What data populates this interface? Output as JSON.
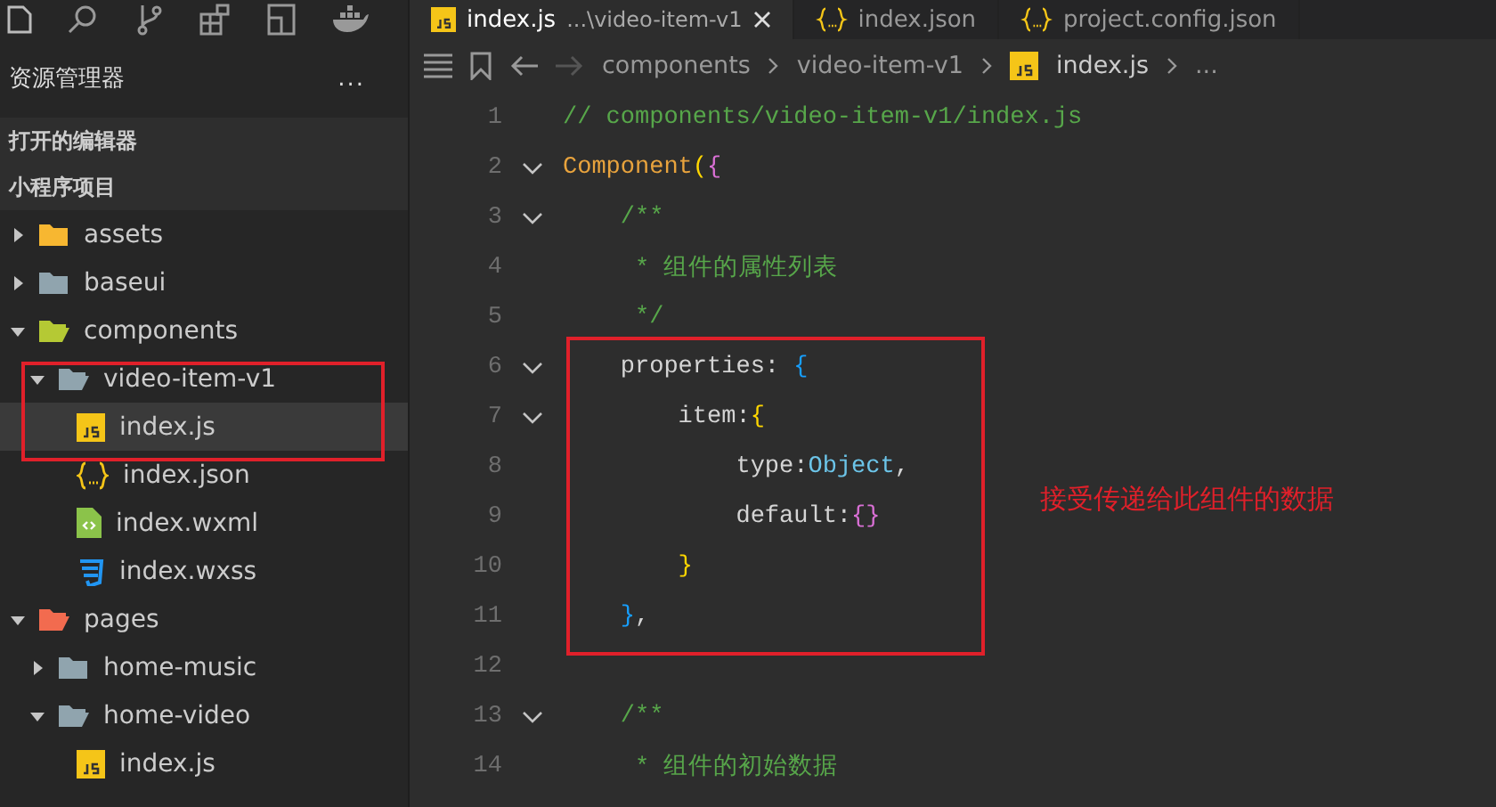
{
  "tabs": [
    {
      "label": "index.js",
      "description": "...\\video-item-v1",
      "kind": "js",
      "selected": true
    },
    {
      "label": "index.json",
      "kind": "json",
      "selected": false
    },
    {
      "label": "project.config.json",
      "kind": "json",
      "selected": false
    }
  ],
  "sidebar": {
    "title": "资源管理器",
    "more": "...",
    "sections": [
      "打开的编辑器",
      "小程序项目"
    ],
    "tree": [
      {
        "label": "assets",
        "kind": "folder-assets",
        "expanded": false
      },
      {
        "label": "baseui",
        "kind": "folder",
        "expanded": false
      },
      {
        "label": "components",
        "kind": "folder-components",
        "expanded": true,
        "children": [
          {
            "label": "video-item-v1",
            "kind": "folder",
            "expanded": true,
            "children": [
              {
                "label": "index.js",
                "kind": "js",
                "selected": true
              },
              {
                "label": "index.json",
                "kind": "json",
                "selected": false
              },
              {
                "label": "index.wxml",
                "kind": "wxml",
                "selected": false
              },
              {
                "label": "index.wxss",
                "kind": "wxss",
                "selected": false
              }
            ]
          }
        ]
      },
      {
        "label": "pages",
        "kind": "folder-pages",
        "expanded": true,
        "children": [
          {
            "label": "home-music",
            "kind": "folder",
            "expanded": false
          },
          {
            "label": "home-video",
            "kind": "folder",
            "expanded": true,
            "children": [
              {
                "label": "index.js",
                "kind": "js",
                "selected": false
              }
            ]
          }
        ]
      }
    ]
  },
  "breadcrumb": [
    {
      "label": "components",
      "kind": "folder"
    },
    {
      "label": "video-item-v1",
      "kind": "folder"
    },
    {
      "label": "index.js",
      "kind": "js"
    },
    {
      "label": "...",
      "kind": "more"
    }
  ],
  "code": {
    "lines": [
      {
        "number": "1",
        "fold": false,
        "tokens": [
          {
            "text": "// components/video-item-v1/index.js",
            "kind": "comment"
          }
        ]
      },
      {
        "number": "2",
        "fold": true,
        "tokens": [
          {
            "text": "Component",
            "kind": "function"
          },
          {
            "text": "(",
            "kind": "bracket1"
          },
          {
            "text": "{",
            "kind": "bracket2"
          }
        ]
      },
      {
        "number": "3",
        "fold": true,
        "tokens": [
          {
            "text": "    /**",
            "kind": "comment"
          }
        ]
      },
      {
        "number": "4",
        "fold": false,
        "tokens": [
          {
            "text": "     * 组件的属性列表",
            "kind": "comment"
          }
        ]
      },
      {
        "number": "5",
        "fold": false,
        "tokens": [
          {
            "text": "     */",
            "kind": "comment"
          }
        ]
      },
      {
        "number": "6",
        "fold": true,
        "tokens": [
          {
            "text": "    properties: ",
            "kind": "plain"
          },
          {
            "text": "{",
            "kind": "bracket3"
          }
        ]
      },
      {
        "number": "7",
        "fold": true,
        "tokens": [
          {
            "text": "        item:",
            "kind": "plain"
          },
          {
            "text": "{",
            "kind": "bracket1"
          }
        ]
      },
      {
        "number": "8",
        "fold": false,
        "tokens": [
          {
            "text": "            type:",
            "kind": "plain"
          },
          {
            "text": "Object",
            "kind": "type"
          },
          {
            "text": ",",
            "kind": "plain"
          }
        ]
      },
      {
        "number": "9",
        "fold": false,
        "tokens": [
          {
            "text": "            default:",
            "kind": "plain"
          },
          {
            "text": "{}",
            "kind": "bracket2"
          }
        ]
      },
      {
        "number": "10",
        "fold": false,
        "tokens": [
          {
            "text": "        }",
            "kind": "bracket1"
          }
        ]
      },
      {
        "number": "11",
        "fold": false,
        "tokens": [
          {
            "text": "    }",
            "kind": "bracket3"
          },
          {
            "text": ",",
            "kind": "plain"
          }
        ]
      },
      {
        "number": "12",
        "fold": false
      },
      {
        "number": "13",
        "fold": true,
        "tokens": [
          {
            "text": "    /**",
            "kind": "comment"
          }
        ]
      },
      {
        "number": "14",
        "fold": false,
        "tokens": [
          {
            "text": "     * 组件的初始数据",
            "kind": "comment"
          }
        ]
      }
    ]
  },
  "annotation": {
    "text": "接受传递给此组件的数据"
  }
}
